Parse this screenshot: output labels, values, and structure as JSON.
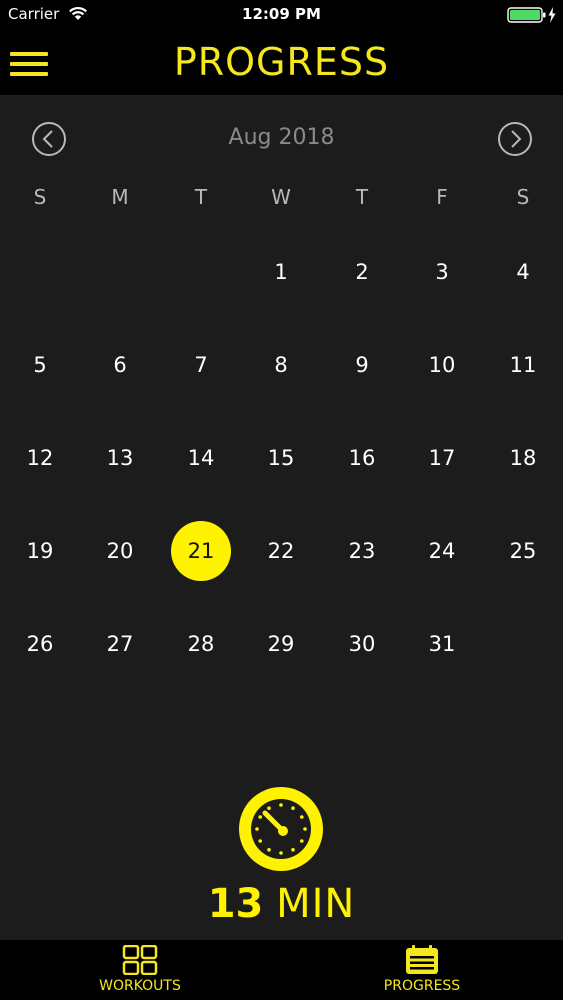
{
  "status_bar": {
    "carrier": "Carrier",
    "time": "12:09 PM",
    "wifi_icon": "wifi-icon",
    "battery_icon": "battery-charging-icon"
  },
  "nav": {
    "title": "PROGRESS",
    "menu_icon": "hamburger-menu-icon"
  },
  "calendar": {
    "month_label": "Aug 2018",
    "prev_icon": "chevron-left-circle-icon",
    "next_icon": "chevron-right-circle-icon",
    "weekdays": [
      "S",
      "M",
      "T",
      "W",
      "T",
      "F",
      "S"
    ],
    "weeks": [
      [
        "",
        "",
        "",
        "1",
        "2",
        "3",
        "4"
      ],
      [
        "5",
        "6",
        "7",
        "8",
        "9",
        "10",
        "11"
      ],
      [
        "12",
        "13",
        "14",
        "15",
        "16",
        "17",
        "18"
      ],
      [
        "19",
        "20",
        "21",
        "22",
        "23",
        "24",
        "25"
      ],
      [
        "26",
        "27",
        "28",
        "29",
        "30",
        "31",
        ""
      ]
    ],
    "selected_day": "21"
  },
  "summary": {
    "icon": "stopwatch-icon",
    "value": "13",
    "unit": "MIN"
  },
  "tabs": [
    {
      "label": "WORKOUTS",
      "icon": "grid-icon"
    },
    {
      "label": "PROGRESS",
      "icon": "calendar-icon"
    }
  ],
  "colors": {
    "accent": "#fff200",
    "title_yellow": "#f4e71e",
    "background": "#1c1c1c",
    "bar_background": "#000000",
    "month_label_gray": "#8a8a8a",
    "battery_green": "#4cd964"
  }
}
